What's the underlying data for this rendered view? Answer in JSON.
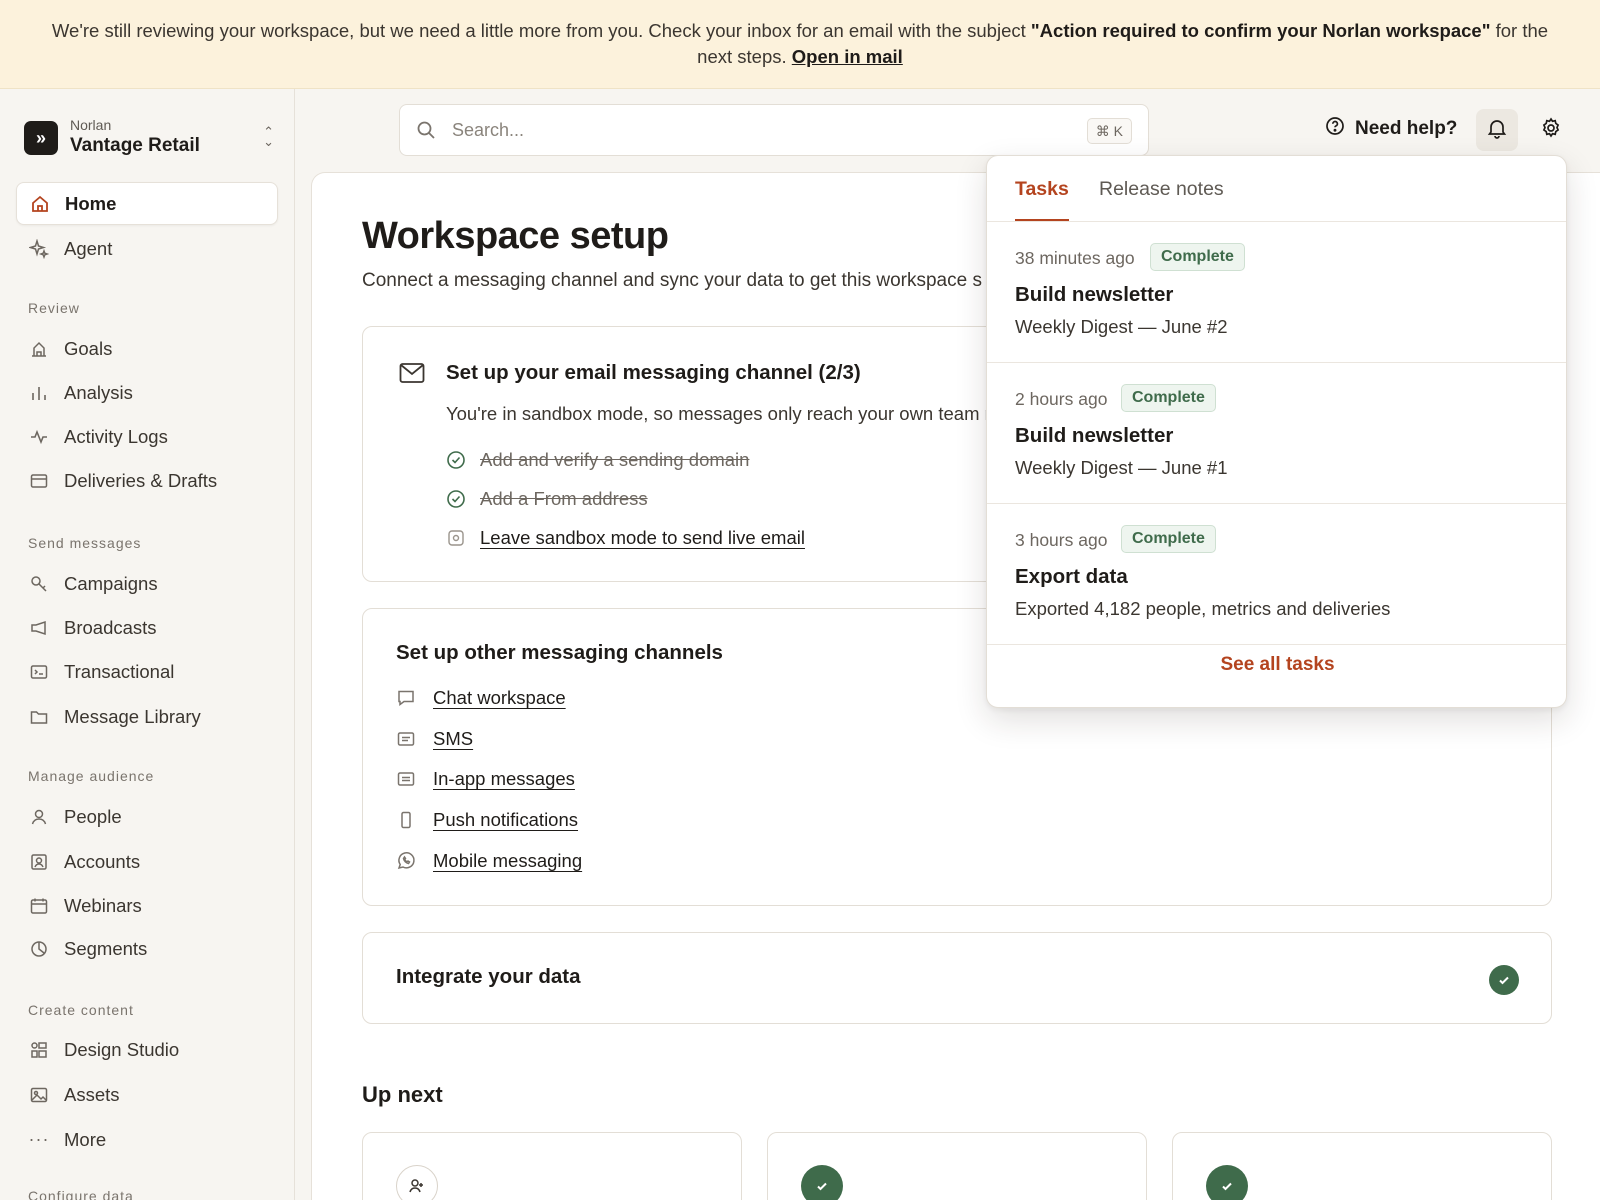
{
  "banner": {
    "text_before": "We're still reviewing your workspace, but we need a little more from you. Check your inbox for an email with the subject ",
    "subject": "\"Action required to confirm your Norlan workspace\"",
    "text_after": " for the next steps. ",
    "link": "Open in mail"
  },
  "workspace": {
    "org": "Norlan",
    "name": "Vantage Retail"
  },
  "sidebar": {
    "top": [
      {
        "label": "Home",
        "icon": "home-icon"
      },
      {
        "label": "Agent",
        "icon": "sparkle-icon"
      }
    ],
    "sections": [
      {
        "title": "Review",
        "items": [
          {
            "label": "Goals"
          },
          {
            "label": "Analysis"
          },
          {
            "label": "Activity Logs"
          },
          {
            "label": "Deliveries & Drafts"
          }
        ]
      },
      {
        "title": "Send messages",
        "items": [
          {
            "label": "Campaigns"
          },
          {
            "label": "Broadcasts"
          },
          {
            "label": "Transactional"
          },
          {
            "label": "Message Library"
          }
        ]
      },
      {
        "title": "Manage audience",
        "items": [
          {
            "label": "People"
          },
          {
            "label": "Accounts"
          },
          {
            "label": "Webinars"
          },
          {
            "label": "Segments"
          }
        ]
      },
      {
        "title": "Create content",
        "items": [
          {
            "label": "Design Studio"
          },
          {
            "label": "Assets"
          },
          {
            "label": "More"
          }
        ]
      },
      {
        "title": "Configure data"
      }
    ]
  },
  "search": {
    "placeholder": "Search...",
    "shortcut": "⌘ K"
  },
  "header": {
    "help_label": "Need help?"
  },
  "page": {
    "title": "Workspace setup",
    "subtitle": "Connect a messaging channel and sync your data to get this workspace set up."
  },
  "email_card": {
    "title": "Set up your email messaging channel (2/3)",
    "description": "You're in sandbox mode, so messages only reach your own team members.",
    "steps": [
      {
        "label": "Add and verify a sending domain",
        "done": true
      },
      {
        "label": "Add a From address",
        "done": true
      },
      {
        "label": "Leave sandbox mode to send live email",
        "done": false
      }
    ]
  },
  "channels_card": {
    "title": "Set up other messaging channels",
    "items": [
      {
        "label": "Chat workspace",
        "icon": "chat-icon"
      },
      {
        "label": "SMS",
        "icon": "sms-icon"
      },
      {
        "label": "In-app messages",
        "icon": "in-app-icon"
      },
      {
        "label": "Push notifications",
        "icon": "phone-icon"
      },
      {
        "label": "Mobile messaging",
        "icon": "whatsapp-icon"
      }
    ]
  },
  "integrate_card": {
    "title": "Integrate your data"
  },
  "up_next": {
    "title": "Up next"
  },
  "popover": {
    "tabs": [
      {
        "label": "Tasks",
        "active": true
      },
      {
        "label": "Release notes",
        "active": false
      }
    ],
    "tasks": [
      {
        "time": "38 minutes ago",
        "status": "Complete",
        "title": "Build newsletter",
        "description": "Weekly Digest — June #2"
      },
      {
        "time": "2 hours ago",
        "status": "Complete",
        "title": "Build newsletter",
        "description": "Weekly Digest — June #1"
      },
      {
        "time": "3 hours ago",
        "status": "Complete",
        "title": "Export data",
        "description": "Exported 4,182 people, metrics and deliveries"
      }
    ],
    "see_all": "See all tasks"
  },
  "colors": {
    "accent": "#b4441f",
    "success": "#3f6b4b",
    "banner_bg": "#fcf2dc"
  }
}
